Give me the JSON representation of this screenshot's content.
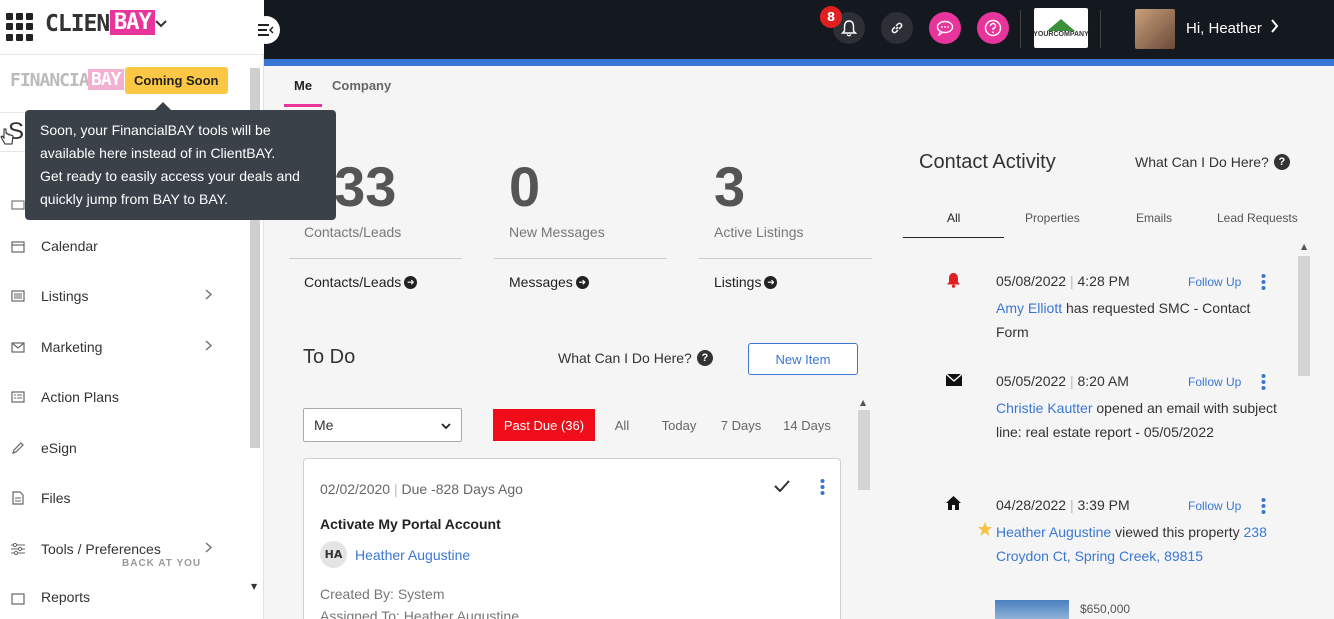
{
  "brand": {
    "client": "CLIENT",
    "bay": "BAY",
    "chevron": "⌄"
  },
  "financial": {
    "name": "FINANCIAL",
    "bay": "BAY",
    "coming_soon": "Coming Soon"
  },
  "tooltip": {
    "lines": [
      "Soon, your FinancialBAY tools will be",
      "available here instead of in ClientBAY.",
      "Get ready to easily access your deals and",
      "quickly jump from BAY to BAY."
    ]
  },
  "header": {
    "notification_count": "8",
    "greeting": "Hi, Heather",
    "company_logo_text": "YOURCOMPANY"
  },
  "sidebar": {
    "partial_letter": "S",
    "items": [
      {
        "label": "Calendar",
        "icon": "calendar-icon",
        "has_children": false
      },
      {
        "label": "Listings",
        "icon": "listings-icon",
        "has_children": true
      },
      {
        "label": "Marketing",
        "icon": "envelope-icon",
        "has_children": true
      },
      {
        "label": "Action Plans",
        "icon": "action-plans-icon",
        "has_children": false
      },
      {
        "label": "eSign",
        "icon": "pen-icon",
        "has_children": false
      },
      {
        "label": "Files",
        "icon": "file-icon",
        "has_children": false
      },
      {
        "label": "Tools / Preferences",
        "icon": "sliders-icon",
        "has_children": true
      },
      {
        "label": "Reports",
        "icon": "reports-icon",
        "has_children": false
      }
    ],
    "bottom_text": "BACK AT YOU"
  },
  "tabs": {
    "me": "Me",
    "company": "Company"
  },
  "stats": [
    {
      "number": "133",
      "label": "Contacts/Leads",
      "link": "Contacts/Leads"
    },
    {
      "number": "0",
      "label": "New Messages",
      "link": "Messages"
    },
    {
      "number": "3",
      "label": "Active Listings",
      "link": "Listings"
    }
  ],
  "todo": {
    "title": "To Do",
    "help": "What Can I Do Here?",
    "new_item": "New Item",
    "assignee_select": "Me",
    "filters": [
      "Past Due (36)",
      "All",
      "Today",
      "7 Days",
      "14 Days"
    ],
    "card": {
      "date": "02/02/2020",
      "due": "Due -828 Days Ago",
      "title": "Activate My Portal Account",
      "initials": "HA",
      "person": "Heather Augustine",
      "created_by": "Created By: System",
      "assigned_to": "Assigned To: Heather Augustine"
    }
  },
  "activity": {
    "title": "Contact Activity",
    "help": "What Can I Do Here?",
    "tabs": [
      "All",
      "Properties",
      "Emails",
      "Lead Requests"
    ],
    "follow_up": "Follow Up",
    "items": [
      {
        "date": "05/08/2022",
        "time": "4:28 PM",
        "name": "Amy Elliott",
        "text": " has requested SMC - Contact Form",
        "icon": "bell-icon"
      },
      {
        "date": "05/05/2022",
        "time": "8:20 AM",
        "name": "Christie Kautter",
        "text": " opened an email with subject line: real estate report - 05/05/2022",
        "icon": "envelope-icon"
      },
      {
        "date": "04/28/2022",
        "time": "3:39 PM",
        "name": "Heather Augustine",
        "text": " viewed this property ",
        "link2": "238 Croydon Ct, Spring Creek, 89815",
        "icon": "home-icon",
        "price": "$650,000"
      }
    ]
  },
  "colors": {
    "accent_pink": "#e8359b",
    "accent_blue": "#3a77d4",
    "topbar": "#14181f",
    "past_due_red": "#f00c18",
    "coming_soon_yellow": "#fcc744"
  }
}
